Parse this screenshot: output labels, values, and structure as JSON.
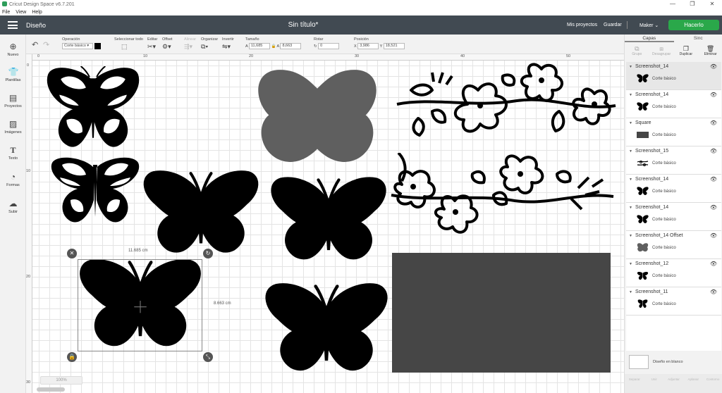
{
  "window": {
    "title": "Cricut Design Space  v6.7.201",
    "min": "—",
    "max": "❐",
    "close": "✕"
  },
  "menu": [
    "File",
    "View",
    "Help"
  ],
  "topnav": {
    "screen": "Diseño",
    "project": "Sin título*",
    "my_projects": "Mis proyectos",
    "save": "Guardar",
    "machine": "Maker",
    "make": "Hacerlo"
  },
  "toolbar": {
    "operation_label": "Operación",
    "operation_value": "Corte básico",
    "select_all": "Seleccionar todo",
    "edit": "Editar",
    "offset": "Offset",
    "align": "Alinear",
    "arrange": "Organizar",
    "flip": "Invertir",
    "size": "Tamaño",
    "size_w_label": "A",
    "size_w": "11,685",
    "size_h_label": "A",
    "size_h": "8,663",
    "rotate": "Rotar",
    "rotate_value": "0",
    "position": "Posición",
    "pos_x_label": "X",
    "pos_x": "3,986",
    "pos_y_label": "Y",
    "pos_y": "18,521"
  },
  "sidebar": [
    {
      "icon": "plus-icon",
      "label": "Nuevo"
    },
    {
      "icon": "shirt-icon",
      "label": "Plantillas"
    },
    {
      "icon": "projects-icon",
      "label": "Proyectos"
    },
    {
      "icon": "image-icon",
      "label": "Imágenes"
    },
    {
      "icon": "text-icon",
      "label": "Texto"
    },
    {
      "icon": "shapes-icon",
      "label": "Formas"
    },
    {
      "icon": "upload-icon",
      "label": "Subir"
    }
  ],
  "ruler": {
    "x": [
      "0",
      "10",
      "20",
      "30",
      "40",
      "50"
    ],
    "y": [
      "0",
      "10",
      "20",
      "30"
    ]
  },
  "selection": {
    "width_label": "11.685 cm",
    "height_label": "8.663 cm"
  },
  "zoom": "100%",
  "panel": {
    "tabs": [
      "Capas",
      "Sinc"
    ],
    "actions": [
      "Grupo",
      "Desagrupar",
      "Duplicar",
      "Eliminar"
    ],
    "layers": [
      {
        "name": "Screenshot_14",
        "op": "Corte básico"
      },
      {
        "name": "Screenshot_14",
        "op": "Corte básico"
      },
      {
        "name": "Square",
        "op": "Corte básico"
      },
      {
        "name": "Screenshot_15",
        "op": "Corte básico"
      },
      {
        "name": "Screenshot_14",
        "op": "Corte básico"
      },
      {
        "name": "Screenshot_14",
        "op": "Corte básico"
      },
      {
        "name": "Screenshot_14 Offset",
        "op": "Corte básico"
      },
      {
        "name": "Screenshot_12",
        "op": "Corte básico"
      },
      {
        "name": "Screenshot_11",
        "op": "Corte básico"
      }
    ],
    "blank": "Diseño en blanco",
    "bottom": [
      "Separar",
      "Unir",
      "Adjuntar",
      "Aplanar",
      "Contorno"
    ]
  },
  "colors": {
    "nav": "#414a52",
    "make": "#2aa84a",
    "shape_dark": "#000000",
    "shape_gray": "#5f5f5f",
    "square": "#464646"
  }
}
